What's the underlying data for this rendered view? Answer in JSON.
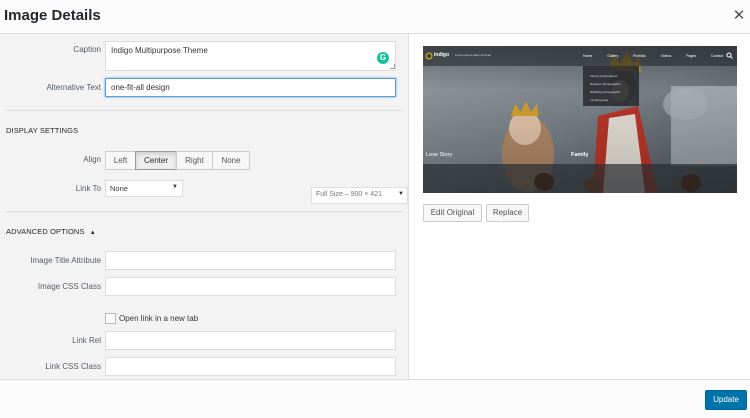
{
  "dialog": {
    "title": "Image Details",
    "close_icon": "close-icon"
  },
  "fields": {
    "caption_label": "Caption",
    "caption_value": "Indigo Multipurpose Theme",
    "alt_label": "Alternative Text",
    "alt_value": "one-fit-all design"
  },
  "display_settings": {
    "heading": "DISPLAY SETTINGS",
    "align_label": "Align",
    "align_options": [
      "Left",
      "Center",
      "Right",
      "None"
    ],
    "align_selected": "Center",
    "link_to_label": "Link To",
    "link_to_value": "None",
    "size_value": "Full Size – 900 × 421"
  },
  "advanced": {
    "heading": "ADVANCED OPTIONS",
    "expanded_icon": "triangle-up-icon",
    "title_attr_label": "Image Title Attribute",
    "title_attr_value": "",
    "css_class_label": "Image CSS Class",
    "css_class_value": "",
    "new_tab_label": "Open link in a new tab",
    "new_tab_checked": false,
    "link_rel_label": "Link Rel",
    "link_rel_value": "",
    "link_css_label": "Link CSS Class",
    "link_css_value": ""
  },
  "preview": {
    "site_name": "Indigo",
    "site_tagline": "Lorem ipsum dolor sit amet",
    "nav": [
      "Home",
      "Gallery",
      "Portfolio",
      "Videos",
      "Pages",
      "Contact"
    ],
    "dropdown": [
      "Family photographer",
      "Newborn photographer",
      "Wedding photographer",
      "Landing page"
    ],
    "left_caption": "Love Story",
    "center_caption": "Family",
    "search_icon": "search-icon"
  },
  "actions": {
    "edit_original": "Edit Original",
    "replace": "Replace",
    "update": "Update"
  },
  "colors": {
    "primary": "#0073aa",
    "grammarly": "#15c39a",
    "accent_gold": "#d9a62e",
    "accent_red": "#c0392b"
  }
}
